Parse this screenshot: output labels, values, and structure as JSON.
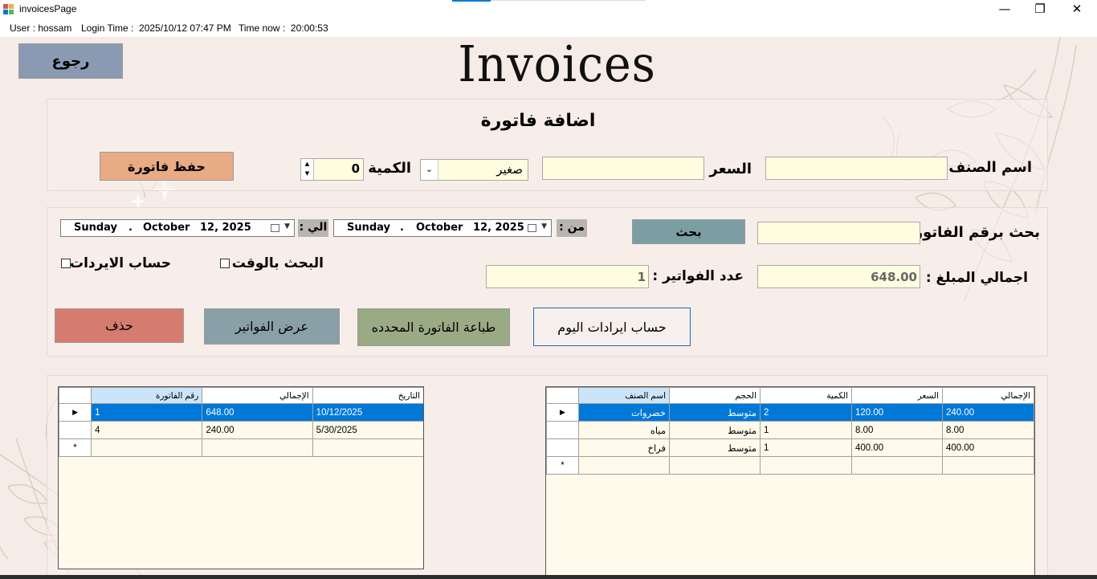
{
  "window": {
    "title": "invoicesPage",
    "controls": {
      "minimize": "—",
      "maximize": "❐",
      "close": "✕"
    }
  },
  "status": {
    "user": "User : hossam",
    "login_time": "Login Time :  2025/10/12 07:47 PM",
    "time_now": "Time now :  20:00:53"
  },
  "page_title": "Invoices",
  "back_button": "رجوع",
  "add_invoice": {
    "heading": "اضافة فاتورة",
    "item_name_label": "اسم الصنف",
    "item_name_value": "",
    "price_label": "السعر",
    "price_value": "",
    "size_value": "صغير",
    "quantity_label": "الكمية",
    "quantity_value": "0",
    "save_button": "حفظ فاتورة"
  },
  "search": {
    "invoice_number_label": "بحث برقم الفاتورة",
    "invoice_number_value": "",
    "search_button": "بحث",
    "from_label": "من :",
    "to_label": "الي :",
    "from_date": {
      "day": "Sunday",
      "month": "October",
      "date": "12, 2025"
    },
    "to_date": {
      "day": "Sunday",
      "month": "October",
      "date": "12, 2025"
    },
    "search_by_time_label": "البحث بالوقت",
    "revenue_calc_label": "حساب الايردات",
    "total_amount_label": "اجمالي المبلغ :",
    "total_amount_value": "648.00",
    "invoice_count_label": "عدد الفواتير :",
    "invoice_count_value": "1"
  },
  "actions": {
    "today_revenue": "حساب ايرادات اليوم",
    "print_selected": "طباعة الفاتورة المحدده",
    "show_invoices": "عرض الفواتير",
    "delete": "حذف"
  },
  "invoices_grid": {
    "columns": [
      "رقم الفاتورة",
      "الإجمالي",
      "التاريخ"
    ],
    "rows": [
      [
        "1",
        "648.00",
        "10/12/2025"
      ],
      [
        "4",
        "240.00",
        "5/30/2025"
      ]
    ],
    "row_marker": "▶",
    "new_row_marker": "*"
  },
  "items_grid": {
    "columns": [
      "اسم الصنف",
      "الحجم",
      "الكمية",
      "السعر",
      "الإجمالي"
    ],
    "rows": [
      [
        "خضروات",
        "متوسط",
        "2",
        "120.00",
        "240.00"
      ],
      [
        "مياه",
        "متوسط",
        "1",
        "8.00",
        "8.00"
      ],
      [
        "فراخ",
        "متوسط",
        "1",
        "400.00",
        "400.00"
      ]
    ],
    "row_marker": "▶",
    "new_row_marker": "*"
  },
  "colors": {
    "background": "#f5ece7",
    "field_bg": "#fffde0",
    "back_btn": "#8a9ab2",
    "save_btn": "#e8ab84",
    "search_btn": "#7b9ea3",
    "show_btn": "#8aa0a8",
    "print_btn": "#9aaa84",
    "delete_btn": "#d67b70",
    "selection": "#0078d7"
  },
  "icons": {
    "app": "app-icon",
    "spinner": "spin-updown-icon",
    "dropdown": "chevron-down-icon",
    "calendar": "calendar-icon"
  }
}
